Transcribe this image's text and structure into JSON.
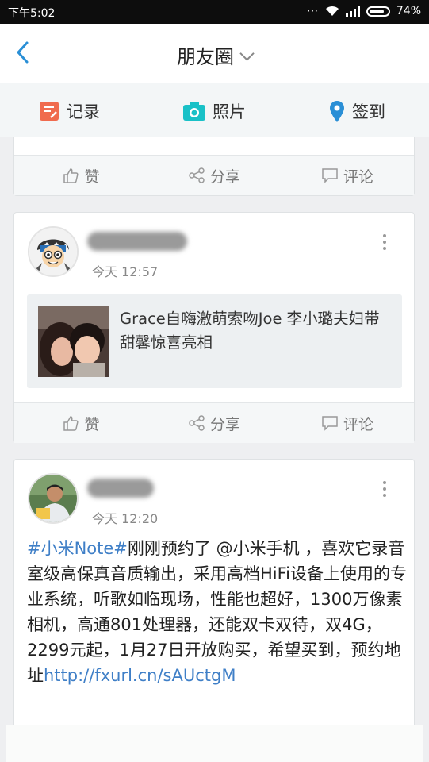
{
  "status_bar": {
    "time": "下午5:02",
    "battery": "74%",
    "battery_level": 0.74
  },
  "header": {
    "title": "朋友圈"
  },
  "actions": [
    {
      "label": "记录"
    },
    {
      "label": "照片"
    },
    {
      "label": "签到"
    }
  ],
  "bar_labels": {
    "like": "赞",
    "share": "分享",
    "comment": "评论"
  },
  "posts": [
    {
      "time": "今天 12:57",
      "link_title": "Grace自嗨激萌索吻Joe 李小璐夫妇带甜馨惊喜亮相"
    },
    {
      "time": "今天 12:20",
      "hashtag": "#小米Note#",
      "text": "刚刚预约了 @小米手机 ，喜欢它录音室级高保真音质输出，采用高档HiFi设备上使用的专业系统，听歌如临现场，性能也超好，1300万像素相机，高通801处理器，还能双卡双待，双4G，2299元起，1月27日开放购买，希望买到，预约地址",
      "link": "http://fxurl.cn/sAUctgM"
    }
  ],
  "colors": {
    "accent": "#2a8fd6",
    "link": "#3f7fc7",
    "record_icon": "#f06b4e",
    "photo_icon": "#19c1c7",
    "checkin_icon": "#2a8fd6"
  }
}
